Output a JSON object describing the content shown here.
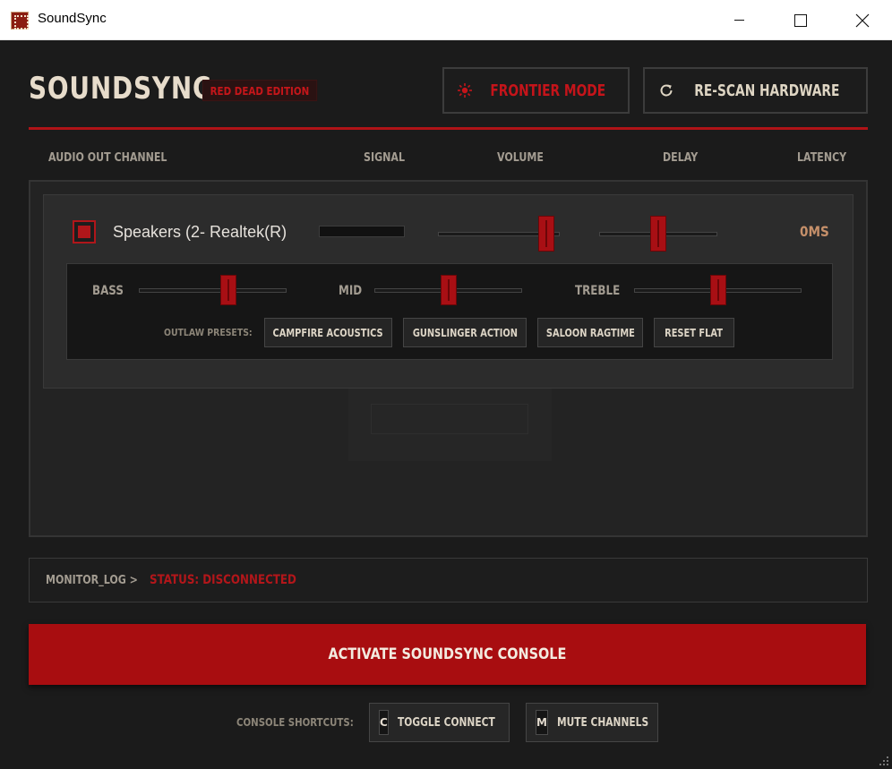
{
  "window": {
    "title": "SoundSync"
  },
  "header": {
    "logo": "SOUNDSYNC",
    "edition": "RED DEAD EDITION",
    "frontier_label": "FRONTIER MODE",
    "rescan_label": "RE-SCAN HARDWARE"
  },
  "columns": {
    "channel": "AUDIO OUT CHANNEL",
    "signal": "SIGNAL",
    "volume": "VOLUME",
    "delay": "DELAY",
    "latency": "LATENCY"
  },
  "channel": {
    "name": "Speakers (2- Realtek(R)",
    "enabled": true,
    "signal_level": 0,
    "volume": 0.95,
    "delay": 0.5,
    "latency": "0MS"
  },
  "eq": {
    "bass_label": "BASS",
    "mid_label": "MID",
    "treble_label": "TREBLE",
    "bass": 0.62,
    "mid": 0.5,
    "treble": 0.5,
    "presets_label": "OUTLAW PRESETS:",
    "presets": [
      "CAMPFIRE ACOUSTICS",
      "GUNSLINGER ACTION",
      "SALOON RAGTIME",
      "RESET FLAT"
    ]
  },
  "log": {
    "prefix": "MONITOR_LOG >",
    "status": "STATUS: DISCONNECTED"
  },
  "activate_label": "ACTIVATE SOUNDSYNC CONSOLE",
  "shortcuts": {
    "label": "CONSOLE SHORTCUTS:",
    "connect_key": "C",
    "connect_label": "TOGGLE CONNECT",
    "mute_key": "M",
    "mute_label": "MUTE CHANNELS"
  },
  "colors": {
    "accent": "#a80d10",
    "bg": "#1b1b1b",
    "text": "#ded5c3",
    "latency": "#c6906a"
  }
}
